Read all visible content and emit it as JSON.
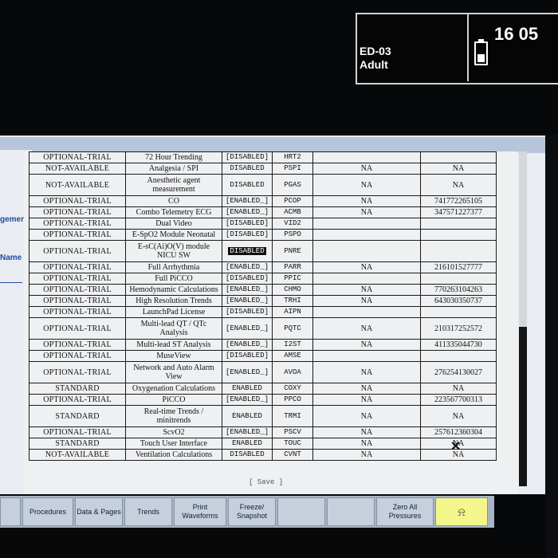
{
  "status": {
    "bed": "ED-03",
    "patient": "Adult",
    "time": "16 05"
  },
  "side_links": [
    "gement",
    "Name"
  ],
  "table": {
    "rows": [
      [
        "OPTIONAL-TRIAL",
        "72 Hour Trending",
        "[DISABLED]",
        "HRT2",
        "",
        ""
      ],
      [
        "NOT-AVAILABLE",
        "Analgesia / SPI",
        "DISABLED",
        "PSPI",
        "NA",
        "NA"
      ],
      [
        "NOT-AVAILABLE",
        "Anesthetic agent measurement",
        "DISABLED",
        "PGAS",
        "NA",
        "NA"
      ],
      [
        "OPTIONAL-TRIAL",
        "CO",
        "[ENABLED_]",
        "PCOP",
        "NA",
        "741772265105"
      ],
      [
        "OPTIONAL-TRIAL",
        "Combo Telemetry ECG",
        "[ENABLED_]",
        "ACMB",
        "NA",
        "347571227377"
      ],
      [
        "OPTIONAL-TRIAL",
        "Dual Video",
        "[DISABLED]",
        "VID2",
        "",
        ""
      ],
      [
        "OPTIONAL-TRIAL",
        "E-SpO2 Module Neonatal",
        "[DISABLED]",
        "PSPO",
        "",
        ""
      ],
      [
        "OPTIONAL-TRIAL",
        "E-sC(Ai)O(V) module NICU SW",
        "DISABLED",
        "PNRE",
        "",
        ""
      ],
      [
        "OPTIONAL-TRIAL",
        "Full Arrhythmia",
        "[ENABLED_]",
        "PARR",
        "NA",
        "216101527777"
      ],
      [
        "OPTIONAL-TRIAL",
        "Full PiCCO",
        "[DISABLED]",
        "PPIC",
        "",
        ""
      ],
      [
        "OPTIONAL-TRIAL",
        "Hemodynamic Calculations",
        "[ENABLED_]",
        "CHMO",
        "NA",
        "770263104263"
      ],
      [
        "OPTIONAL-TRIAL",
        "High Resolution Trends",
        "[ENABLED_]",
        "TRHI",
        "NA",
        "643030350737"
      ],
      [
        "OPTIONAL-TRIAL",
        "LaunchPad License",
        "[DISABLED]",
        "AIPN",
        "",
        ""
      ],
      [
        "OPTIONAL-TRIAL",
        "Multi-lead QT / QTc Analysis",
        "[ENABLED_]",
        "PQTC",
        "NA",
        "210317252572"
      ],
      [
        "OPTIONAL-TRIAL",
        "Multi-lead ST Analysis",
        "[ENABLED_]",
        "I2ST",
        "NA",
        "411335044730"
      ],
      [
        "OPTIONAL-TRIAL",
        "MuseView",
        "[DISABLED]",
        "AMSE",
        "",
        ""
      ],
      [
        "OPTIONAL-TRIAL",
        "Network and Auto Alarm View",
        "[ENABLED_]",
        "AVOA",
        "NA",
        "276254130027"
      ],
      [
        "STANDARD",
        "Oxygenation Calculations",
        "ENABLED",
        "COXY",
        "NA",
        "NA"
      ],
      [
        "OPTIONAL-TRIAL",
        "PiCCO",
        "[ENABLED_]",
        "PPCO",
        "NA",
        "223567700313"
      ],
      [
        "STANDARD",
        "Real-time Trends / minitrends",
        "ENABLED",
        "TRMI",
        "NA",
        "NA"
      ],
      [
        "OPTIONAL-TRIAL",
        "ScvO2",
        "[ENABLED_]",
        "PSCV",
        "NA",
        "257612360304"
      ],
      [
        "STANDARD",
        "Touch User Interface",
        "ENABLED",
        "TOUC",
        "NA",
        "NA"
      ],
      [
        "NOT-AVAILABLE",
        "Ventilation Calculations",
        "DISABLED",
        "CVNT",
        "NA",
        "NA"
      ]
    ]
  },
  "save_label": "[ Save ]",
  "taskbar": {
    "buttons": [
      {
        "label": "Procedures"
      },
      {
        "label": "Data & Pages"
      },
      {
        "label": "Trends"
      },
      {
        "label": "Print Waveforms"
      },
      {
        "label": "Freeze/ Snapshot"
      },
      {
        "label": "Zero All Pressures"
      }
    ]
  }
}
